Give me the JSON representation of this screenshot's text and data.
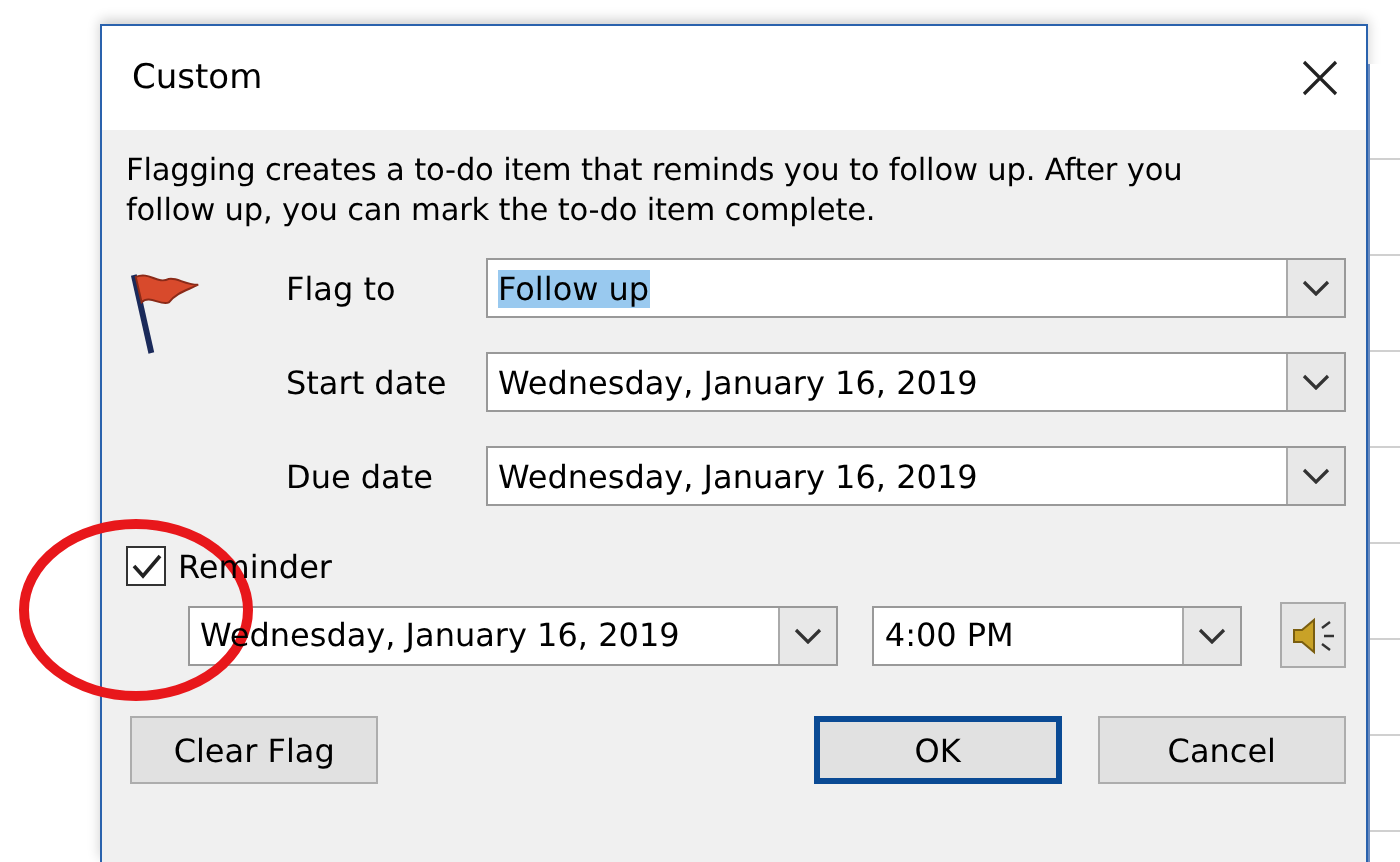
{
  "window": {
    "title": "Custom"
  },
  "description": "Flagging creates a to-do item that reminds you to follow up. After you follow up, you can mark the to-do item complete.",
  "fields": [
    {
      "label": "Flag to",
      "value": "Follow up",
      "text_selected": true
    },
    {
      "label": "Start date",
      "value": "Wednesday, January 16, 2019",
      "text_selected": false
    },
    {
      "label": "Due date",
      "value": "Wednesday, January 16, 2019",
      "text_selected": false
    }
  ],
  "reminder": {
    "label": "Reminder",
    "checked": true,
    "date": "Wednesday, January 16, 2019",
    "time": "4:00 PM"
  },
  "buttons": [
    {
      "label": "Clear Flag",
      "default": false
    },
    {
      "label": "OK",
      "default": true
    },
    {
      "label": "Cancel",
      "default": false
    }
  ],
  "annotation": {
    "kind": "circle",
    "color": "#e8171b"
  }
}
